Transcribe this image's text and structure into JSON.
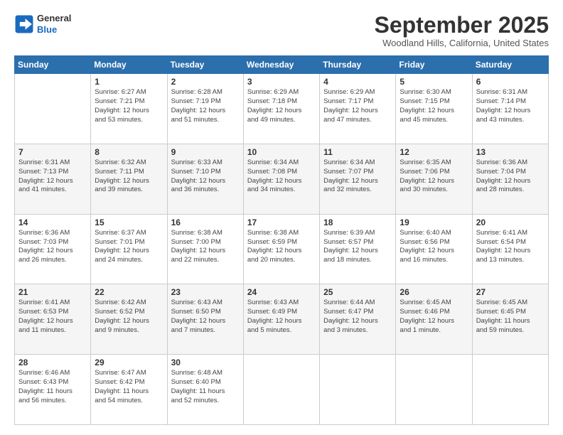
{
  "header": {
    "logo_line1": "General",
    "logo_line2": "Blue",
    "month_title": "September 2025",
    "location": "Woodland Hills, California, United States"
  },
  "weekdays": [
    "Sunday",
    "Monday",
    "Tuesday",
    "Wednesday",
    "Thursday",
    "Friday",
    "Saturday"
  ],
  "weeks": [
    [
      {
        "day": "",
        "info": ""
      },
      {
        "day": "1",
        "info": "Sunrise: 6:27 AM\nSunset: 7:21 PM\nDaylight: 12 hours\nand 53 minutes."
      },
      {
        "day": "2",
        "info": "Sunrise: 6:28 AM\nSunset: 7:19 PM\nDaylight: 12 hours\nand 51 minutes."
      },
      {
        "day": "3",
        "info": "Sunrise: 6:29 AM\nSunset: 7:18 PM\nDaylight: 12 hours\nand 49 minutes."
      },
      {
        "day": "4",
        "info": "Sunrise: 6:29 AM\nSunset: 7:17 PM\nDaylight: 12 hours\nand 47 minutes."
      },
      {
        "day": "5",
        "info": "Sunrise: 6:30 AM\nSunset: 7:15 PM\nDaylight: 12 hours\nand 45 minutes."
      },
      {
        "day": "6",
        "info": "Sunrise: 6:31 AM\nSunset: 7:14 PM\nDaylight: 12 hours\nand 43 minutes."
      }
    ],
    [
      {
        "day": "7",
        "info": "Sunrise: 6:31 AM\nSunset: 7:13 PM\nDaylight: 12 hours\nand 41 minutes."
      },
      {
        "day": "8",
        "info": "Sunrise: 6:32 AM\nSunset: 7:11 PM\nDaylight: 12 hours\nand 39 minutes."
      },
      {
        "day": "9",
        "info": "Sunrise: 6:33 AM\nSunset: 7:10 PM\nDaylight: 12 hours\nand 36 minutes."
      },
      {
        "day": "10",
        "info": "Sunrise: 6:34 AM\nSunset: 7:08 PM\nDaylight: 12 hours\nand 34 minutes."
      },
      {
        "day": "11",
        "info": "Sunrise: 6:34 AM\nSunset: 7:07 PM\nDaylight: 12 hours\nand 32 minutes."
      },
      {
        "day": "12",
        "info": "Sunrise: 6:35 AM\nSunset: 7:06 PM\nDaylight: 12 hours\nand 30 minutes."
      },
      {
        "day": "13",
        "info": "Sunrise: 6:36 AM\nSunset: 7:04 PM\nDaylight: 12 hours\nand 28 minutes."
      }
    ],
    [
      {
        "day": "14",
        "info": "Sunrise: 6:36 AM\nSunset: 7:03 PM\nDaylight: 12 hours\nand 26 minutes."
      },
      {
        "day": "15",
        "info": "Sunrise: 6:37 AM\nSunset: 7:01 PM\nDaylight: 12 hours\nand 24 minutes."
      },
      {
        "day": "16",
        "info": "Sunrise: 6:38 AM\nSunset: 7:00 PM\nDaylight: 12 hours\nand 22 minutes."
      },
      {
        "day": "17",
        "info": "Sunrise: 6:38 AM\nSunset: 6:59 PM\nDaylight: 12 hours\nand 20 minutes."
      },
      {
        "day": "18",
        "info": "Sunrise: 6:39 AM\nSunset: 6:57 PM\nDaylight: 12 hours\nand 18 minutes."
      },
      {
        "day": "19",
        "info": "Sunrise: 6:40 AM\nSunset: 6:56 PM\nDaylight: 12 hours\nand 16 minutes."
      },
      {
        "day": "20",
        "info": "Sunrise: 6:41 AM\nSunset: 6:54 PM\nDaylight: 12 hours\nand 13 minutes."
      }
    ],
    [
      {
        "day": "21",
        "info": "Sunrise: 6:41 AM\nSunset: 6:53 PM\nDaylight: 12 hours\nand 11 minutes."
      },
      {
        "day": "22",
        "info": "Sunrise: 6:42 AM\nSunset: 6:52 PM\nDaylight: 12 hours\nand 9 minutes."
      },
      {
        "day": "23",
        "info": "Sunrise: 6:43 AM\nSunset: 6:50 PM\nDaylight: 12 hours\nand 7 minutes."
      },
      {
        "day": "24",
        "info": "Sunrise: 6:43 AM\nSunset: 6:49 PM\nDaylight: 12 hours\nand 5 minutes."
      },
      {
        "day": "25",
        "info": "Sunrise: 6:44 AM\nSunset: 6:47 PM\nDaylight: 12 hours\nand 3 minutes."
      },
      {
        "day": "26",
        "info": "Sunrise: 6:45 AM\nSunset: 6:46 PM\nDaylight: 12 hours\nand 1 minute."
      },
      {
        "day": "27",
        "info": "Sunrise: 6:45 AM\nSunset: 6:45 PM\nDaylight: 11 hours\nand 59 minutes."
      }
    ],
    [
      {
        "day": "28",
        "info": "Sunrise: 6:46 AM\nSunset: 6:43 PM\nDaylight: 11 hours\nand 56 minutes."
      },
      {
        "day": "29",
        "info": "Sunrise: 6:47 AM\nSunset: 6:42 PM\nDaylight: 11 hours\nand 54 minutes."
      },
      {
        "day": "30",
        "info": "Sunrise: 6:48 AM\nSunset: 6:40 PM\nDaylight: 11 hours\nand 52 minutes."
      },
      {
        "day": "",
        "info": ""
      },
      {
        "day": "",
        "info": ""
      },
      {
        "day": "",
        "info": ""
      },
      {
        "day": "",
        "info": ""
      }
    ]
  ]
}
